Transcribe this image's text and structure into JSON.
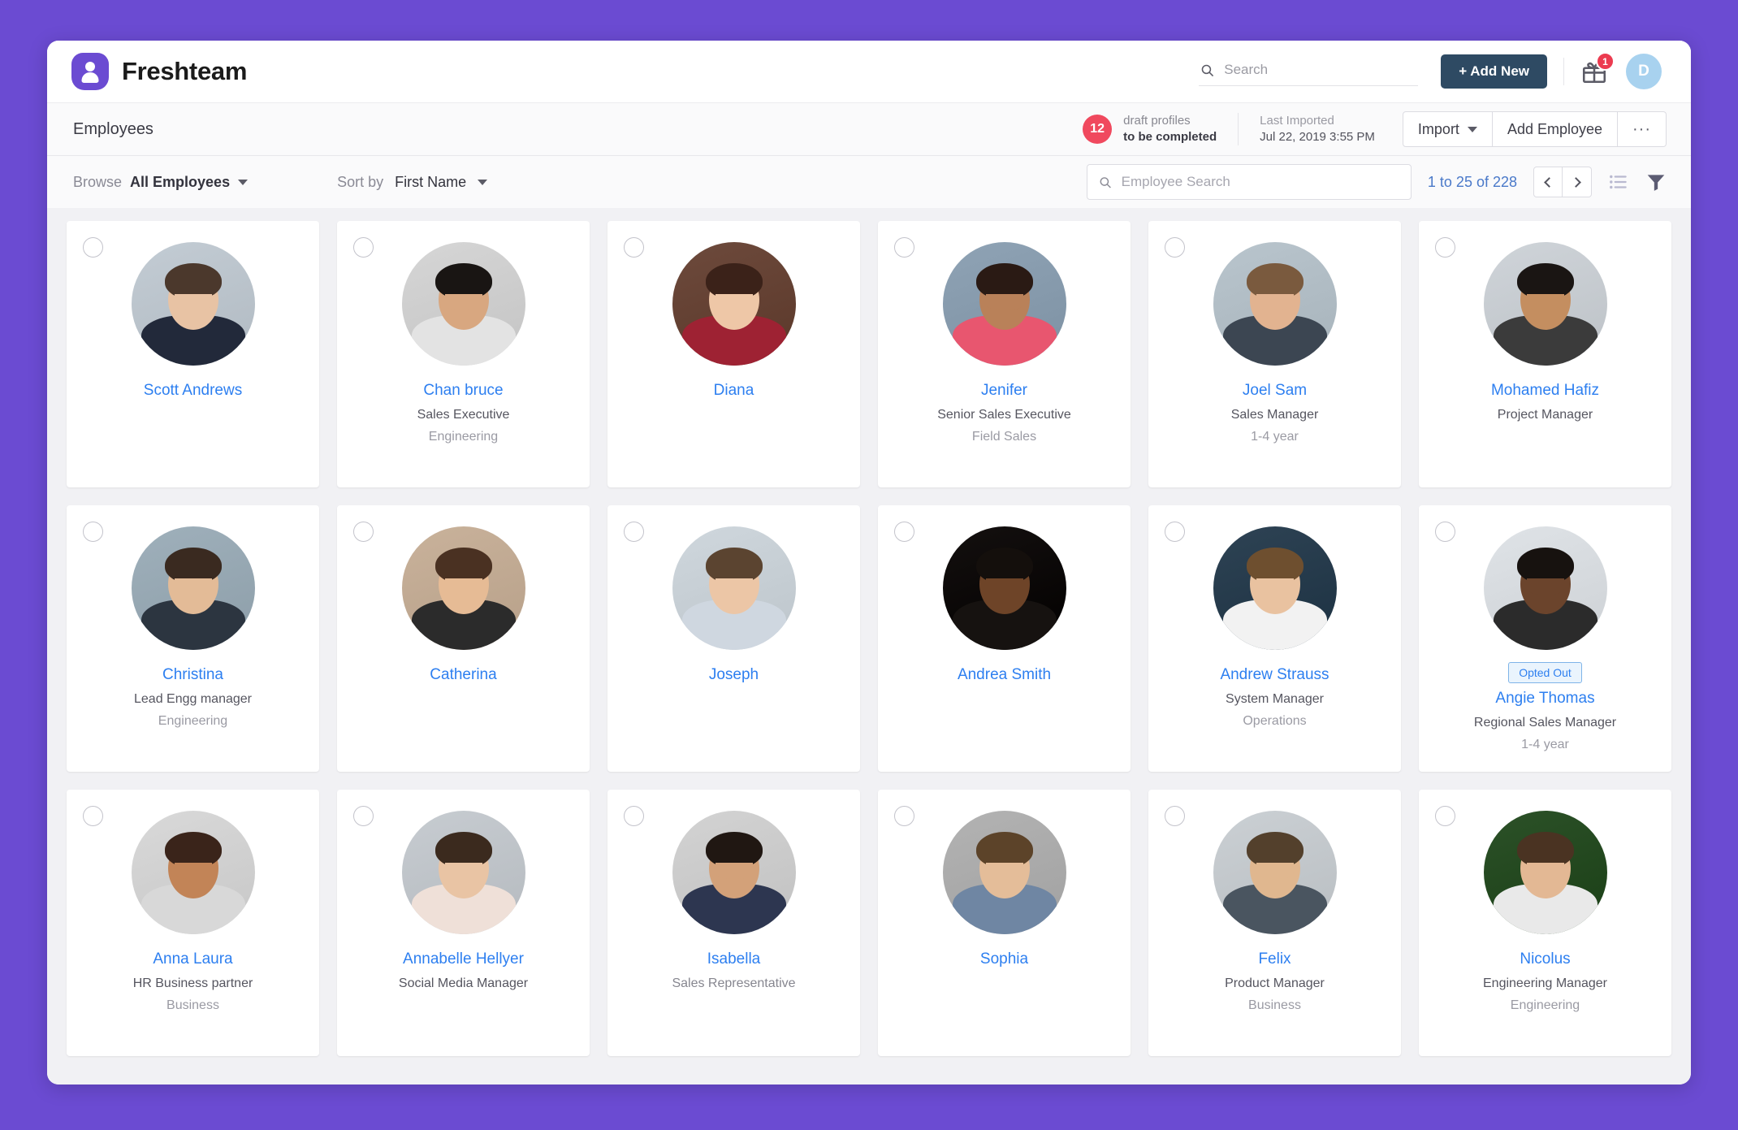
{
  "theme": {
    "page_background": "#6B4BD2",
    "accent_blue": "#2d7ff0",
    "add_new_bg": "#2e4a63",
    "badge_red": "#f0495e"
  },
  "header": {
    "brand_name": "Freshteam",
    "search_placeholder": "Search",
    "add_new_label": "+ Add New",
    "gift_badge_count": "1",
    "user_avatar_initial": "D"
  },
  "subheader": {
    "page_title": "Employees",
    "draft_count": "12",
    "draft_line1": "draft profiles",
    "draft_line2": "to be completed",
    "last_imported_label": "Last Imported",
    "last_imported_value": "Jul 22, 2019 3:55 PM",
    "import_label": "Import",
    "add_employee_label": "Add Employee",
    "more_label": "···"
  },
  "toolbar": {
    "browse_label": "Browse",
    "browse_value": "All Employees",
    "sortby_label": "Sort by",
    "sortby_value": "First Name",
    "employee_search_placeholder": "Employee Search",
    "pagination": "1 to 25 of 228"
  },
  "employees": [
    {
      "name": "Scott Andrews",
      "title": "",
      "dept": "",
      "badge": ""
    },
    {
      "name": "Chan bruce",
      "title": "Sales Executive",
      "dept": "Engineering",
      "badge": ""
    },
    {
      "name": "Diana",
      "title": "",
      "dept": "",
      "badge": ""
    },
    {
      "name": "Jenifer",
      "title": "Senior Sales Executive",
      "dept": "Field Sales",
      "badge": ""
    },
    {
      "name": "Joel Sam",
      "title": "Sales Manager",
      "dept": "1-4 year",
      "badge": ""
    },
    {
      "name": "Mohamed Hafiz",
      "title": "Project Manager",
      "dept": "",
      "badge": ""
    },
    {
      "name": "Christina",
      "title": "Lead Engg manager",
      "dept": "Engineering",
      "badge": ""
    },
    {
      "name": "Catherina",
      "title": "",
      "dept": "",
      "badge": ""
    },
    {
      "name": "Joseph",
      "title": "",
      "dept": "",
      "badge": ""
    },
    {
      "name": "Andrea Smith",
      "title": "",
      "dept": "",
      "badge": ""
    },
    {
      "name": "Andrew Strauss",
      "title": "System Manager",
      "dept": "Operations",
      "badge": ""
    },
    {
      "name": "Angie Thomas",
      "title": "Regional Sales Manager",
      "dept": "1-4 year",
      "badge": "Opted Out"
    },
    {
      "name": "Anna Laura",
      "title": "HR Business partner",
      "dept": "Business",
      "badge": ""
    },
    {
      "name": "Annabelle Hellyer",
      "title": "Social Media Manager",
      "dept": "",
      "badge": ""
    },
    {
      "name": "Isabella",
      "title": "Sales Representative",
      "dept": "",
      "badge": ""
    },
    {
      "name": "Sophia",
      "title": "",
      "dept": "",
      "badge": ""
    },
    {
      "name": "Felix",
      "title": "Product Manager",
      "dept": "Business",
      "badge": ""
    },
    {
      "name": "Nicolus",
      "title": "Engineering Manager",
      "dept": "Engineering",
      "badge": ""
    }
  ]
}
